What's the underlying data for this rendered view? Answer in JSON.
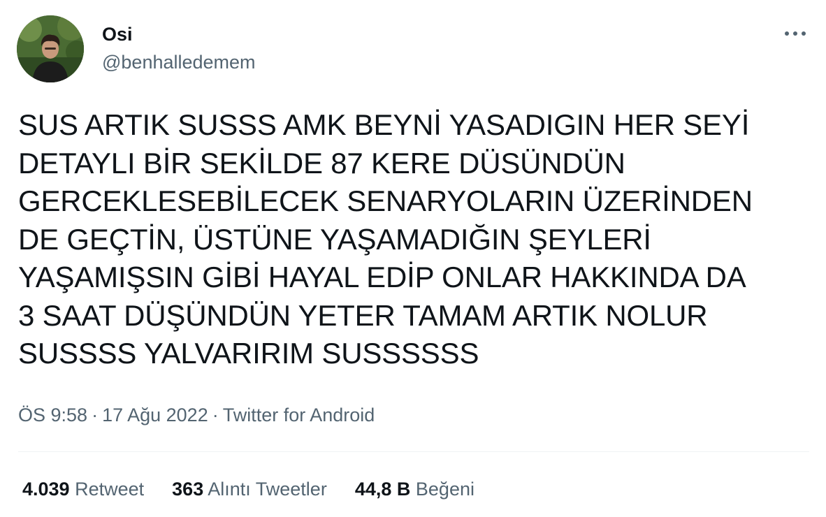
{
  "author": {
    "display_name": "Osi",
    "handle": "@benhalledemem"
  },
  "tweet": {
    "text": "SUS ARTIK SUSSS AMK BEYNİ YASADIGIN HER SEYİ\nDETAYLI BİR SEKİLDE 87 KERE DÜSÜNDÜN\nGERCEKLESEBİLECEK SENARYOLARIN ÜZERİNDEN\nDE GEÇTİN, ÜSTÜNE YAŞAMADIĞIN ŞEYLERİ\nYAŞAMIŞSIN GİBİ HAYAL EDİP ONLAR HAKKINDA DA\n3 SAAT DÜŞÜNDÜN YETER TAMAM ARTIK NOLUR\nSUSSSS YALVARIRIM SUSSSSSS"
  },
  "meta": {
    "time": "ÖS 9:58",
    "separator": "·",
    "date": "17 Ağu 2022",
    "source": "Twitter for Android"
  },
  "stats": {
    "retweets": {
      "count": "4.039",
      "label": "Retweet"
    },
    "quotes": {
      "count": "363",
      "label": "Alıntı Tweetler"
    },
    "likes": {
      "count": "44,8 B",
      "label": "Beğeni"
    }
  },
  "icons": {
    "more": "more-horizontal-icon"
  },
  "colors": {
    "text_primary": "#0f1419",
    "text_secondary": "#536471",
    "divider": "#eff3f4"
  }
}
